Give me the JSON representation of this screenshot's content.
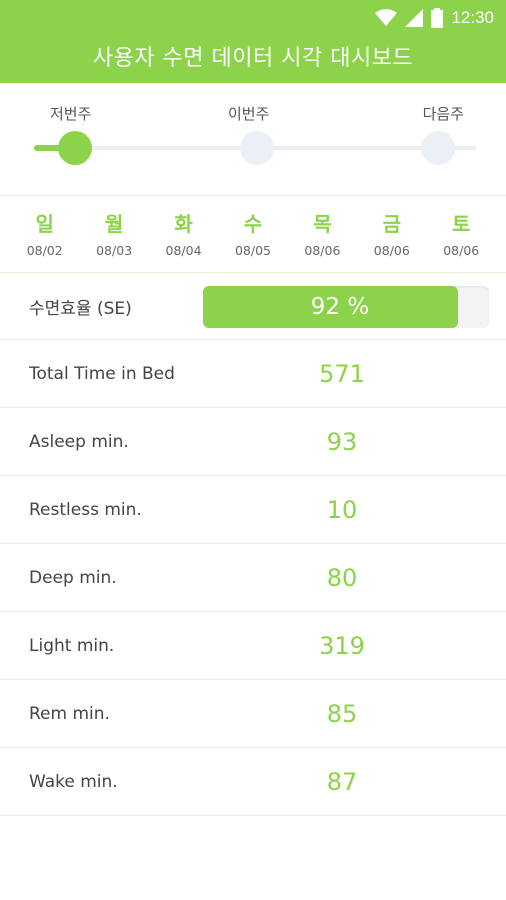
{
  "status": {
    "time": "12:30"
  },
  "header": {
    "title": "사용자 수면 데이터 시각 대시보드"
  },
  "weeks": {
    "prev": "저번주",
    "this": "이번주",
    "next": "다음주",
    "selected_index": 0
  },
  "days": [
    {
      "name": "일",
      "date": "08/02"
    },
    {
      "name": "월",
      "date": "08/03"
    },
    {
      "name": "화",
      "date": "08/04"
    },
    {
      "name": "수",
      "date": "08/05"
    },
    {
      "name": "목",
      "date": "08/06"
    },
    {
      "name": "금",
      "date": "08/06"
    },
    {
      "name": "토",
      "date": "08/06"
    }
  ],
  "sleep_efficiency": {
    "label": "수면효율 (SE)",
    "value": "92 %",
    "percent": 92
  },
  "metrics": [
    {
      "label": "Total Time in Bed",
      "value": "571"
    },
    {
      "label": "Asleep min.",
      "value": "93"
    },
    {
      "label": "Restless min.",
      "value": "10"
    },
    {
      "label": "Deep min.",
      "value": "80"
    },
    {
      "label": "Light min.",
      "value": "319"
    },
    {
      "label": "Rem min.",
      "value": "85"
    },
    {
      "label": "Wake min.",
      "value": "87"
    }
  ],
  "colors": {
    "accent": "#8cd24a",
    "divider": "#e8f3da",
    "inactive_dot": "#eaf0f6"
  }
}
